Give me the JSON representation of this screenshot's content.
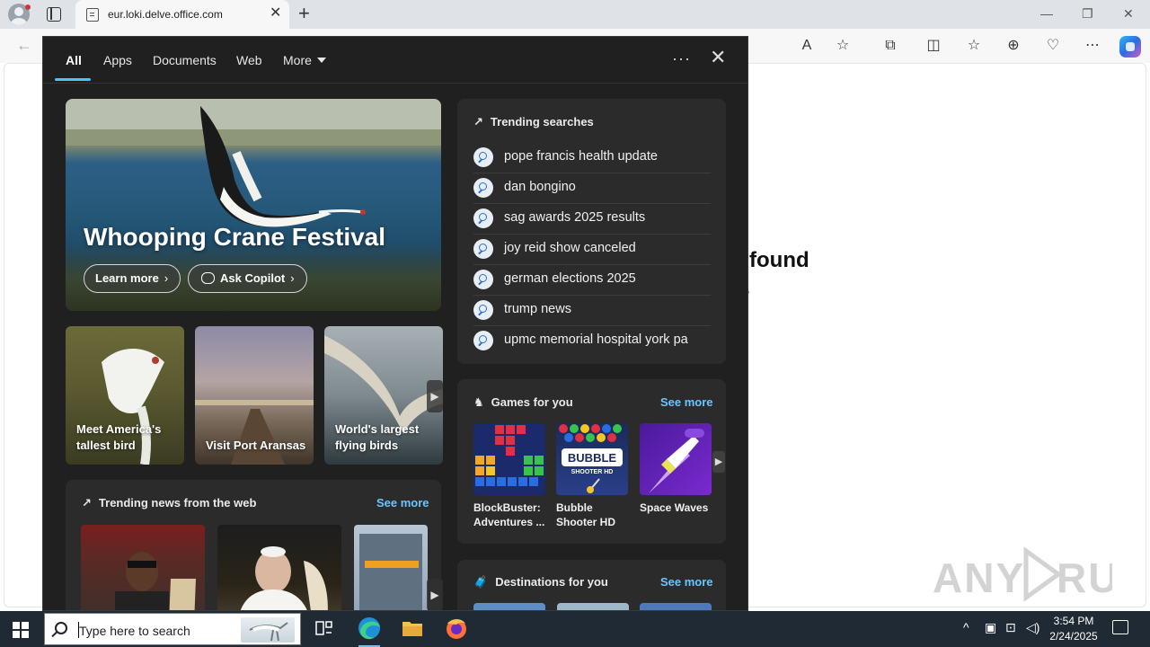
{
  "browser": {
    "tab_title": "eur.loki.delve.office.com",
    "tab_close": "✕",
    "new_tab": "+",
    "window_controls": [
      "—",
      "❐",
      "✕"
    ],
    "toolbar_icons": [
      "read-aloud",
      "favorite",
      "extensions",
      "split-screen",
      "favorites",
      "collections",
      "performance",
      "more"
    ]
  },
  "page_behind": {
    "heading_fragment": "e found",
    "sub_fragment": "y"
  },
  "panel": {
    "tabs": [
      "All",
      "Apps",
      "Documents",
      "Web",
      "More"
    ],
    "active_tab": "All",
    "more_dots": "···",
    "close": "✕",
    "hero": {
      "title": "Whooping Crane Festival",
      "learn_more": "Learn more",
      "ask_copilot": "Ask Copilot"
    },
    "cards": [
      {
        "label": "Meet America's tallest bird"
      },
      {
        "label": "Visit Port Aransas"
      },
      {
        "label": "World's largest flying birds"
      }
    ],
    "news": {
      "title": "Trending news from the web",
      "see_more": "See more"
    },
    "trending": {
      "title": "Trending searches",
      "items": [
        "pope francis health update",
        "dan bongino",
        "sag awards 2025 results",
        "joy reid show canceled",
        "german elections 2025",
        "trump news",
        "upmc memorial hospital york pa"
      ]
    },
    "games": {
      "title": "Games for you",
      "see_more": "See more",
      "items": [
        {
          "name": "BlockBuster: Adventures ..."
        },
        {
          "name": "Bubble Shooter HD"
        },
        {
          "name": "Space Waves"
        }
      ]
    },
    "destinations": {
      "title": "Destinations for you",
      "see_more": "See more"
    }
  },
  "taskbar": {
    "search_placeholder": "Type here to search",
    "time": "3:54 PM",
    "date": "2/24/2025"
  },
  "watermark": "ANY RUN",
  "colors": {
    "panel_bg": "#202020",
    "card_bg": "#2b2b2b",
    "accent": "#4cc2ff",
    "link": "#6cc4ff",
    "taskbar": "#1f2a35"
  }
}
